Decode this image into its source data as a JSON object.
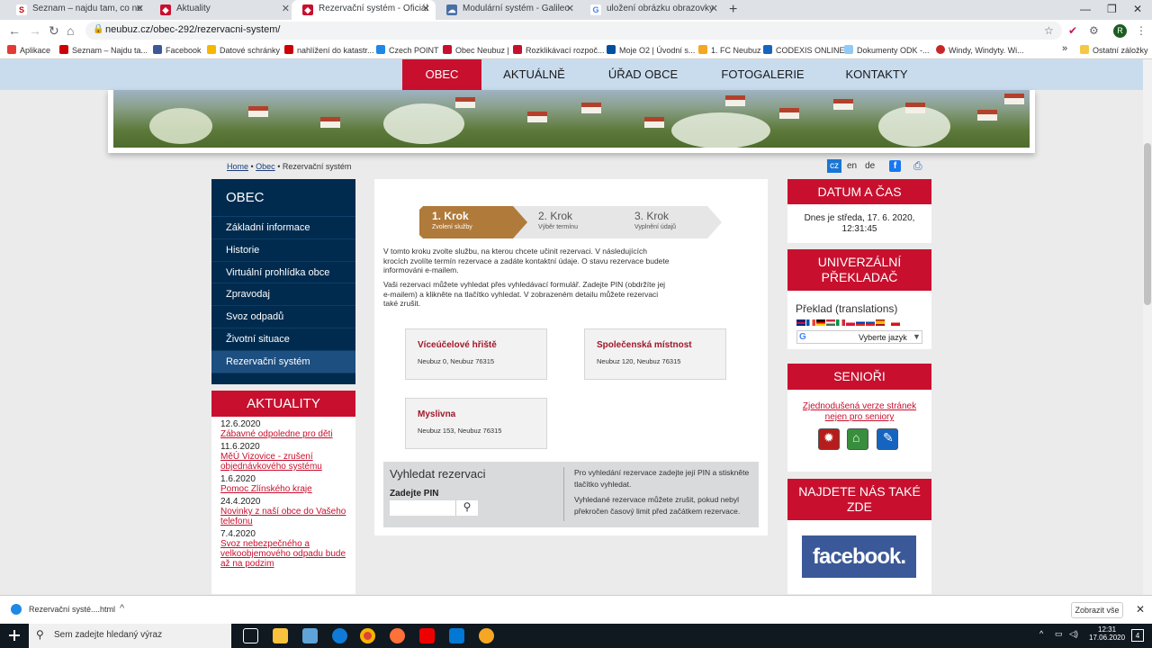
{
  "browser": {
    "tabs": [
      {
        "label": "Seznam – najdu tam, co neznám",
        "icon": "seznam-icon",
        "color": "#cc0000",
        "glyph": "S"
      },
      {
        "label": "Aktuality",
        "icon": "crest-icon",
        "color": "#c8102e",
        "glyph": "◆"
      },
      {
        "label": "Rezervační systém - Oficiální strá",
        "icon": "crest-icon",
        "color": "#c8102e",
        "glyph": "◆"
      },
      {
        "label": "Modulární systém - Galileo Corp",
        "icon": "cloud-icon",
        "color": "#4a6fa5",
        "glyph": "☁"
      },
      {
        "label": "uložení obrázku obrazovky - Hle",
        "icon": "google-icon",
        "color": "#4285f4",
        "glyph": "G"
      }
    ],
    "url": "neubuz.cz/obec-292/rezervacni-system/",
    "profile_initial": "R",
    "bookmarks": [
      {
        "label": "Aplikace",
        "color": "#e53935"
      },
      {
        "label": "Seznam – Najdu ta...",
        "color": "#cc0000"
      },
      {
        "label": "Facebook",
        "color": "#3b5998"
      },
      {
        "label": "Datové schránky",
        "color": "#f5b700"
      },
      {
        "label": "nahlížení do katastr...",
        "color": "#cc0000"
      },
      {
        "label": "Czech POINT",
        "color": "#1e88e5"
      },
      {
        "label": "Obec Neubuz |",
        "color": "#c8102e"
      },
      {
        "label": "Rozklikávací rozpoč...",
        "color": "#c8102e"
      },
      {
        "label": "Moje O2 | Úvodní s...",
        "color": "#0050a0"
      },
      {
        "label": "1. FC Neubuz",
        "color": "#f5a623"
      },
      {
        "label": "CODEXIS ONLINE",
        "color": "#1565c0"
      },
      {
        "label": "Dokumenty ODK -...",
        "color": "#90caf9"
      },
      {
        "label": "Windy, Windyty. Wi...",
        "color": "#c62828"
      }
    ],
    "bookmarks_more": "»",
    "other_bookmarks": "Ostatní záložky"
  },
  "site": {
    "nav": [
      "OBEC",
      "AKTUÁLNĚ",
      "ÚŘAD OBCE",
      "FOTOGALERIE",
      "KONTAKTY"
    ],
    "breadcrumb": {
      "home": "Home",
      "obec": "Obec",
      "current": "Rezervační systém"
    },
    "langs": [
      "cz",
      "en",
      "de"
    ],
    "left_menu": {
      "title": "OBEC",
      "items": [
        "Základní informace",
        "Historie",
        "Virtuální prohlídka obce",
        "Zpravodaj",
        "Svoz odpadů",
        "Životní situace",
        "Rezervační systém"
      ]
    },
    "aktuality": {
      "title": "AKTUALITY",
      "items": [
        {
          "date": "12.6.2020",
          "title": "Zábavné odpoledne pro děti"
        },
        {
          "date": "11.6.2020",
          "title": "MěÚ Vizovice - zrušení objednávkového systému"
        },
        {
          "date": "1.6.2020",
          "title": "Pomoc Zlínského kraje"
        },
        {
          "date": "24.4.2020",
          "title": "Novinky z naší obce do Vašeho telefonu"
        },
        {
          "date": "7.4.2020",
          "title": "Svoz nebezpečného a velkoobjemového odpadu bude až na podzim"
        }
      ]
    },
    "steps": [
      {
        "label": "1. Krok",
        "sub": "Zvolení služby"
      },
      {
        "label": "2. Krok",
        "sub": "Výběr termínu"
      },
      {
        "label": "3. Krok",
        "sub": "Vyplnění údajů"
      }
    ],
    "intro1": "V tomto kroku zvolte službu, na kterou chcete učinit rezervaci. V následujících krocích zvolíte termín rezervace a zadáte kontaktní údaje. O stavu rezervace budete informováni e-mailem.",
    "intro2": "Vaši rezervaci můžete vyhledat přes vyhledávací formulář. Zadejte PIN (obdržíte jej e-mailem) a klikněte na tlačítko vyhledat. V zobrazeném detailu můžete rezervaci také zrušit.",
    "services": [
      {
        "name": "Víceúčelové hřiště",
        "address": "Neubuz 0, Neubuz 76315"
      },
      {
        "name": "Společenská místnost",
        "address": "Neubuz 120, Neubuz 76315"
      },
      {
        "name": "Myslivna",
        "address": "Neubuz 153, Neubuz 76315"
      }
    ],
    "search": {
      "title": "Vyhledat rezervaci",
      "pin_label": "Zadejte PIN",
      "desc1": "Pro vyhledání rezervace zadejte její PIN a stiskněte tlačítko vyhledat.",
      "desc2": "Vyhledané rezervace můžete zrušit, pokud nebyl překročen časový limit před začátkem rezervace."
    },
    "datetime": {
      "title": "DATUM A ČAS",
      "text": "Dnes je středa, 17. 6. 2020, 12:31:45"
    },
    "translator": {
      "title": "UNIVERZÁLNÍ PŘEKLADAČ",
      "label": "Překlad (translations)",
      "select": "Vyberte jazyk"
    },
    "seniors": {
      "title": "SENIOŘI",
      "link": "Zjednodušená verze stránek nejen pro seniory"
    },
    "find_us": {
      "title": "NAJDETE NÁS TAKÉ ZDE",
      "facebook": "facebook."
    }
  },
  "download": {
    "file": "Rezervační systé....html",
    "show_all": "Zobrazit vše"
  },
  "taskbar": {
    "search_placeholder": "Sem zadejte hledaný výraz",
    "time": "12:31",
    "date": "17.06.2020",
    "notif": "4"
  }
}
